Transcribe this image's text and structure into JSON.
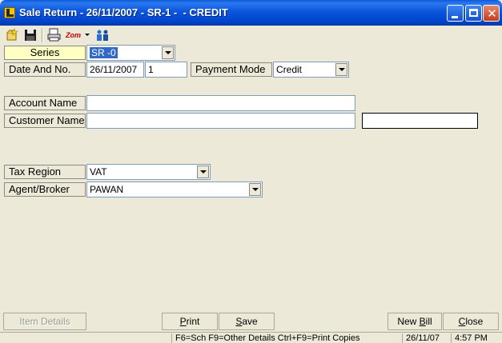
{
  "window": {
    "title": "Sale Return - 26/11/2007 - SR-1 -  - CREDIT"
  },
  "toolbar": {
    "icons": [
      "new-icon",
      "save-disk-icon",
      "print-preview-icon",
      "zoom-icon",
      "users-icon"
    ],
    "zoom_label": "Zom"
  },
  "form": {
    "series_label": "Series",
    "series_value": "SR -0",
    "date_label": "Date And No.",
    "date_value": "26/11/2007",
    "number_value": "1",
    "payment_label": "Payment Mode",
    "payment_value": "Credit",
    "account_label": "Account Name",
    "account_value": "",
    "customer_label": "Customer Name",
    "customer_value": "",
    "extra_value": "",
    "tax_label": "Tax Region",
    "tax_value": "VAT",
    "agent_label": "Agent/Broker",
    "agent_value": "PAWAN"
  },
  "buttons": {
    "item_details": "Item Details",
    "print_u": "P",
    "print_rest": "rint",
    "save_u": "S",
    "save_rest": "ave",
    "newbill_pre": "New ",
    "newbill_u": "B",
    "newbill_rest": "ill",
    "close_u": "C",
    "close_rest": "lose"
  },
  "status": {
    "hint": "F6=Sch F9=Other Details Ctrl+F9=Print Copies",
    "date": "26/11/07",
    "time": "4:57 PM"
  }
}
